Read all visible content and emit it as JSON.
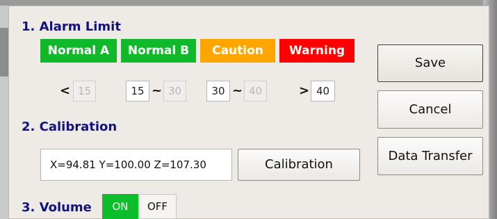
{
  "sections": {
    "alarm_limit": "1. Alarm Limit",
    "calibration": "2. Calibration",
    "volume": "3. Volume"
  },
  "levels": {
    "normal_a": {
      "label": "Normal A",
      "color": "#11b829"
    },
    "normal_b": {
      "label": "Normal B",
      "color": "#11b829"
    },
    "caution": {
      "label": "Caution",
      "color": "#ffa500"
    },
    "warning": {
      "label": "Warning",
      "color": "#ff0000"
    }
  },
  "limits": {
    "normal_a": {
      "symbol": "<",
      "max": "15"
    },
    "normal_b": {
      "min": "15",
      "tilde": "~",
      "max": "30"
    },
    "caution": {
      "min": "30",
      "tilde": "~",
      "max": "40"
    },
    "warning": {
      "symbol": ">",
      "min": "40"
    }
  },
  "calibration": {
    "value": "X=94.81  Y=100.00  Z=107.30",
    "button": "Calibration"
  },
  "volume": {
    "on": "ON",
    "off": "OFF",
    "state": "on",
    "on_color": "#0ebd2b"
  },
  "actions": {
    "save": "Save",
    "cancel": "Cancel",
    "data_transfer": "Data Transfer"
  }
}
